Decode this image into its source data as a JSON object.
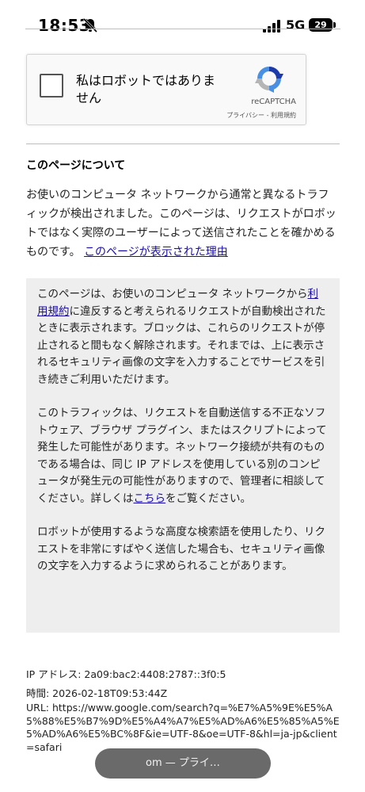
{
  "status_bar": {
    "time": "18:53",
    "network": "5G",
    "battery": "29"
  },
  "captcha": {
    "label": "私はロボットではありません",
    "brand": "reCAPTCHA",
    "links": "プライバシー - 利用規約"
  },
  "about": {
    "title": "このページについて",
    "intro": "お使いのコンピュータ ネットワークから通常と異なるトラフィックが検出されました。このページは、リクエストがロボットではなく実際のユーザーによって送信されたことを確かめるものです。",
    "intro_link": "このページが表示された理由"
  },
  "details": {
    "p1_before": "このページは、お使いのコンピュータ ネットワークから",
    "p1_link": "利用規約",
    "p1_after": "に違反すると考えられるリクエストが自動検出されたときに表示されます。ブロックは、これらのリクエストが停止されると間もなく解除されます。それまでは、上に表示されるセキュリティ画像の文字を入力することでサービスを引き続きご利用いただけます。",
    "p2_before": "このトラフィックは、リクエストを自動送信する不正なソフトウェア、ブラウザ プラグイン、またはスクリプトによって発生した可能性があります。ネットワーク接続が共有のものである場合は、同じ IP アドレスを使用している別のコンピュータが発生元の可能性がありますので、管理者に相談してください。詳しくは",
    "p2_link": "こちら",
    "p2_after": "をご覧ください。",
    "p3": "ロボットが使用するような高度な検索語を使用したり、リクエストを非常にすばやく送信した場合も、セキュリティ画像の文字を入力するように求められることがあります。"
  },
  "info": {
    "ip": "IP アドレス: 2a09:bac2:4408:2787::3f0:5",
    "time": "時間: 2026-02-18T09:53:44Z",
    "url": "URL: https://www.google.com/search?q=%E7%A5%9E%E5%A5%88%E5%B7%9D%E5%A4%A7%E5%AD%A6%E5%85%A5%E5%AD%A6%E5%BC%8F&ie=UTF-8&oe=UTF-8&hl=ja-jp&client=safari"
  },
  "toast": {
    "text": "om — プライ…"
  },
  "colors": {
    "link": "#1a0dab",
    "gray_box": "#eeeeee",
    "recaptcha_blue": "#4a90e2",
    "recaptcha_gray": "#b5b5b5"
  }
}
